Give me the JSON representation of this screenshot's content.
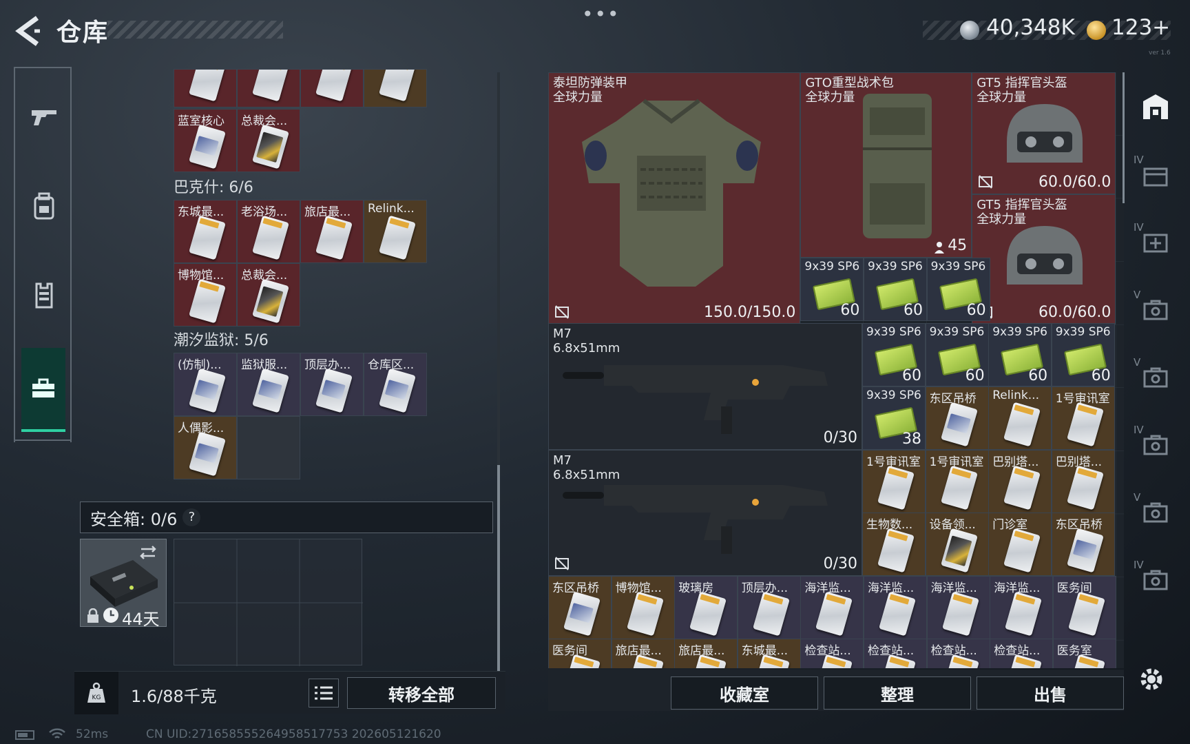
{
  "header": {
    "title": "仓库",
    "menu_dots": "•••",
    "currency_a": "40,348K",
    "currency_b": "123+",
    "version": "ver 1.6"
  },
  "left_nav": {
    "items": [
      "gun-icon",
      "backpack-icon",
      "vest-icon",
      "toolbox-icon"
    ],
    "selected": "toolbox-icon"
  },
  "left_panel": {
    "top_row_partial": [
      {
        "label": "",
        "rarity": "red"
      },
      {
        "label": "",
        "rarity": "red"
      },
      {
        "label": "",
        "rarity": "red"
      },
      {
        "label": "",
        "rarity": "gold"
      }
    ],
    "row_a": [
      {
        "label": "蓝室核心",
        "rarity": "red"
      },
      {
        "label": "总裁会...",
        "rarity": "red"
      }
    ],
    "cat_bakeshi": "巴克什: 6/6",
    "bakeshi_row1": [
      {
        "label": "东城最...",
        "rarity": "red"
      },
      {
        "label": "老浴场...",
        "rarity": "red"
      },
      {
        "label": "旅店最...",
        "rarity": "red"
      },
      {
        "label": "Relink...",
        "rarity": "gold"
      }
    ],
    "bakeshi_row2": [
      {
        "label": "博物馆...",
        "rarity": "red"
      },
      {
        "label": "总裁会...",
        "rarity": "red"
      }
    ],
    "cat_chaoxi": "潮汐监狱: 5/6",
    "chaoxi_row1": [
      {
        "label": "(仿制)...",
        "rarity": "purple"
      },
      {
        "label": "监狱服...",
        "rarity": "purple"
      },
      {
        "label": "顶层办...",
        "rarity": "purple"
      },
      {
        "label": "仓库区...",
        "rarity": "purple"
      }
    ],
    "chaoxi_row2": [
      {
        "label": "人偶影...",
        "rarity": "gold"
      }
    ],
    "safe_box_label": "安全箱: 0/6",
    "safe_box_help": "?",
    "safe_days": "44天",
    "weight": "1.6/88千克",
    "transfer_all": "转移全部"
  },
  "right_panel": {
    "armor": {
      "label": "泰坦防弹装甲\n全球力量",
      "durability": "150.0/150.0"
    },
    "backpack": {
      "label": "GTO重型战术包\n全球力量",
      "capacity": "45"
    },
    "helmet1": {
      "label": "GT5 指挥官头盔\n全球力量",
      "durability": "60.0/60.0"
    },
    "helmet2": {
      "label": "GT5 指挥官头盔\n全球力量",
      "durability": "60.0/60.0"
    },
    "ammo_row1": [
      {
        "label": "9x39 SP6",
        "qty": "60"
      },
      {
        "label": "9x39 SP6",
        "qty": "60"
      },
      {
        "label": "9x39 SP6",
        "qty": "60"
      }
    ],
    "gun1": {
      "label": "M7\n6.8x51mm",
      "ammo": "0/30"
    },
    "gun2": {
      "label": "M7\n6.8x51mm",
      "ammo": "0/30"
    },
    "ammo_row2": [
      {
        "label": "9x39 SP6",
        "qty": "60"
      },
      {
        "label": "9x39 SP6",
        "qty": "60"
      },
      {
        "label": "9x39 SP6",
        "qty": "60"
      },
      {
        "label": "9x39 SP6",
        "qty": "60"
      }
    ],
    "row3": [
      {
        "label": "9x39 SP6",
        "qty": "38",
        "type": "ammo"
      },
      {
        "label": "东区吊桥",
        "type": "card",
        "rarity": "gold"
      },
      {
        "label": "Relink...",
        "type": "card",
        "rarity": "gold"
      },
      {
        "label": "1号审讯室",
        "type": "card",
        "rarity": "gold"
      }
    ],
    "row4": [
      {
        "label": "1号审讯室",
        "rarity": "gold"
      },
      {
        "label": "1号审讯室",
        "rarity": "gold"
      },
      {
        "label": "巴别塔...",
        "rarity": "gold"
      },
      {
        "label": "巴别塔...",
        "rarity": "gold"
      }
    ],
    "row5": [
      {
        "label": "生物数...",
        "rarity": "gold"
      },
      {
        "label": "设备领...",
        "rarity": "gold"
      },
      {
        "label": "门诊室",
        "rarity": "gold"
      },
      {
        "label": "东区吊桥",
        "rarity": "gold"
      }
    ],
    "row6": [
      {
        "label": "东区吊桥",
        "rarity": "gold"
      },
      {
        "label": "博物馆...",
        "rarity": "gold"
      },
      {
        "label": "玻璃房",
        "rarity": "purple"
      },
      {
        "label": "顶层办...",
        "rarity": "purple"
      },
      {
        "label": "海洋监...",
        "rarity": "purple"
      },
      {
        "label": "海洋监...",
        "rarity": "purple"
      },
      {
        "label": "海洋监...",
        "rarity": "purple"
      },
      {
        "label": "海洋监...",
        "rarity": "purple"
      },
      {
        "label": "医务间",
        "rarity": "purple"
      }
    ],
    "row7": [
      {
        "label": "医务间",
        "rarity": "gold"
      },
      {
        "label": "旅店最...",
        "rarity": "gold"
      },
      {
        "label": "旅店最...",
        "rarity": "gold"
      },
      {
        "label": "东城最...",
        "rarity": "gold"
      },
      {
        "label": "检查站...",
        "rarity": "purple"
      },
      {
        "label": "检查站...",
        "rarity": "purple"
      },
      {
        "label": "检查站...",
        "rarity": "purple"
      },
      {
        "label": "检查站...",
        "rarity": "purple"
      },
      {
        "label": "医务室",
        "rarity": "purple"
      }
    ],
    "btn_collection": "收藏室",
    "btn_sort": "整理",
    "btn_sell": "出售"
  },
  "right_nav": {
    "items": [
      {
        "tag": "",
        "icon": "warehouse-icon"
      },
      {
        "tag": "IV",
        "icon": "storage-box-icon"
      },
      {
        "tag": "IV",
        "icon": "medical-box-icon"
      },
      {
        "tag": "V",
        "icon": "case-icon"
      },
      {
        "tag": "V",
        "icon": "case-icon"
      },
      {
        "tag": "IV",
        "icon": "case-icon"
      },
      {
        "tag": "V",
        "icon": "case-icon"
      },
      {
        "tag": "IV",
        "icon": "case-icon"
      }
    ]
  },
  "status": {
    "ping": "52ms",
    "uid": "CN UID:2716585552649585177​53 202605121620"
  },
  "colors": {
    "accent": "#2fd0a2",
    "rarity_red": "#59252a",
    "rarity_gold": "#4d3b24",
    "rarity_purple": "#363448"
  }
}
